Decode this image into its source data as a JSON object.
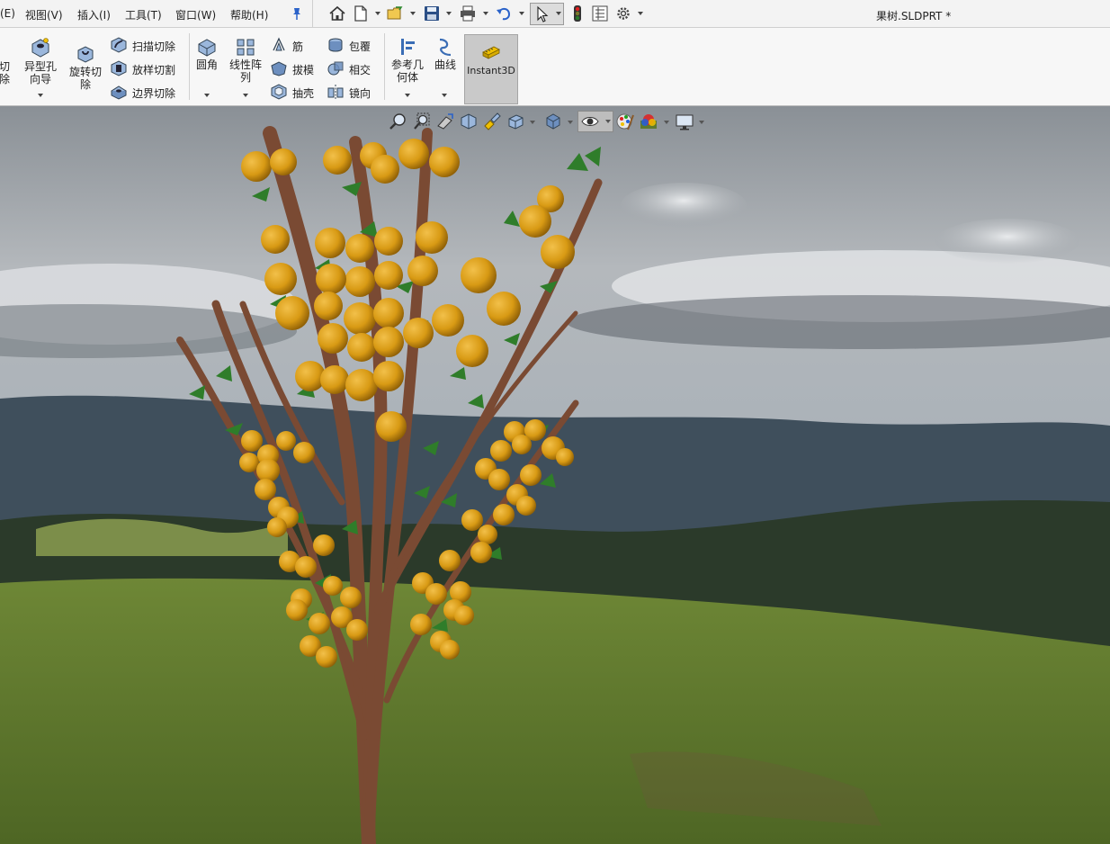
{
  "menu": {
    "items": [
      "(E)",
      "视图(V)",
      "插入(I)",
      "工具(T)",
      "窗口(W)",
      "帮助(H)"
    ]
  },
  "quick_access": {
    "icons": [
      "home-icon",
      "new-document-icon",
      "open-folder-icon",
      "save-icon",
      "print-icon",
      "undo-icon",
      "select-arrow-icon",
      "traffic-light-icon",
      "file-properties-icon",
      "options-gear-icon"
    ]
  },
  "document": {
    "title": "果树.SLDPRT *"
  },
  "ribbon": {
    "cut_partial_label": "切\n除",
    "hole_wizard_label": "异型孔\n向导",
    "revolved_cut_label": "旋转切\n除",
    "swept_cut_label": "扫描切除",
    "lofted_cut_label": "放样切割",
    "boundary_cut_label": "边界切除",
    "fillet_label": "圆角",
    "linear_pattern_label": "线性阵\n列",
    "rib_label": "筋",
    "draft_label": "拔模",
    "shell_label": "抽壳",
    "wrap_label": "包覆",
    "intersect_label": "相交",
    "mirror_label": "镜向",
    "ref_geometry_label": "参考几\n何体",
    "curves_label": "曲线",
    "instant3d_label": "Instant3D"
  },
  "heads_up_toolbar": {
    "icons": [
      "zoom-to-fit-icon",
      "zoom-area-icon",
      "previous-view-icon",
      "section-view-icon",
      "dynamic-annotation-icon",
      "view-orientation-icon",
      "display-style-icon",
      "hide-show-items-icon",
      "edit-appearance-icon",
      "apply-scene-icon",
      "view-settings-icon"
    ]
  },
  "colors": {
    "accent_blue": "#1f5fbf",
    "fruit": "#d89a14",
    "leaf": "#2f7d2a",
    "bark": "#7a4a33",
    "sky": "#9ea3a8",
    "grass": "#5f7a2e"
  }
}
